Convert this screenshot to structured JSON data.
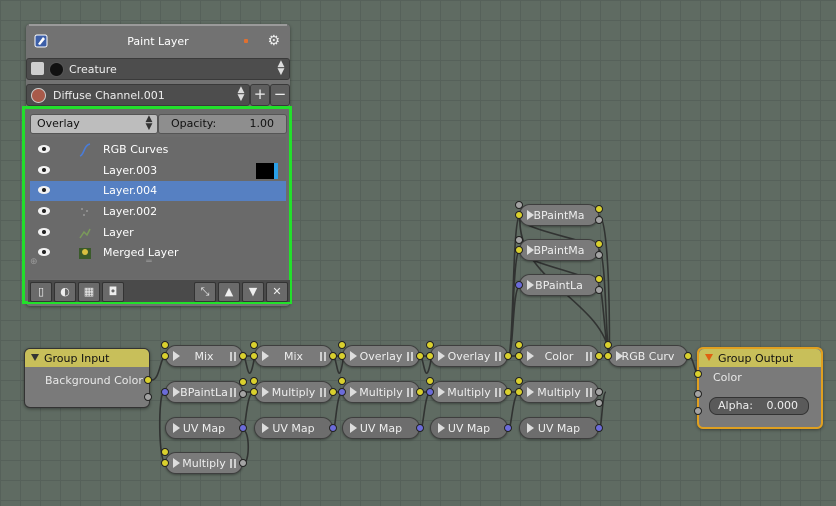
{
  "panel": {
    "title": "Paint Layer",
    "object_select": "Creature",
    "material_select": "Diffuse Channel.001",
    "add_symbol": "+",
    "remove_symbol": "−",
    "blend_mode": "Overlay",
    "opacity_label": "Opacity:",
    "opacity_value": "1.00",
    "layers": [
      {
        "label": "RGB Curves",
        "icon": "rgb-curves-icon",
        "selected": false
      },
      {
        "label": "Layer.003",
        "icon": "",
        "selected": false
      },
      {
        "label": "Layer.004",
        "icon": "",
        "selected": true
      },
      {
        "label": "Layer.002",
        "icon": "",
        "selected": false
      },
      {
        "label": "Layer",
        "icon": "",
        "selected": false
      },
      {
        "label": "Merged Layer",
        "icon": "",
        "selected": false
      }
    ]
  },
  "nodes": {
    "group_input": {
      "title": "Group Input",
      "output": "Background Color"
    },
    "group_output": {
      "title": "Group Output",
      "input": "Color",
      "alpha_label": "Alpha:",
      "alpha_value": "0.000"
    },
    "mix1": "Mix",
    "mix2": "Mix",
    "overlay1": "Overlay",
    "overlay2": "Overlay",
    "color": "Color",
    "rgb_curves": "RGB Curv",
    "bpaintla1": "BPaintLa",
    "multiply1": "Multiply",
    "multiply2": "Multiply",
    "multiply3": "Multiply",
    "multiply4": "Multiply",
    "multiply5": "Multiply",
    "uvmap1": "UV Map",
    "uvmap2": "UV Map",
    "uvmap3": "UV Map",
    "uvmap4": "UV Map",
    "uvmap5": "UV Map",
    "bpaintma1": "BPaintMa",
    "bpaintma2": "BPaintMa",
    "bpaintla2": "BPaintLa"
  },
  "colors": {
    "highlight_border": "#22e02b",
    "selection": "#5680c2",
    "socket_color": "#d9d02e",
    "socket_vector": "#6b6bd9",
    "group_header": "#c8bf5a"
  }
}
